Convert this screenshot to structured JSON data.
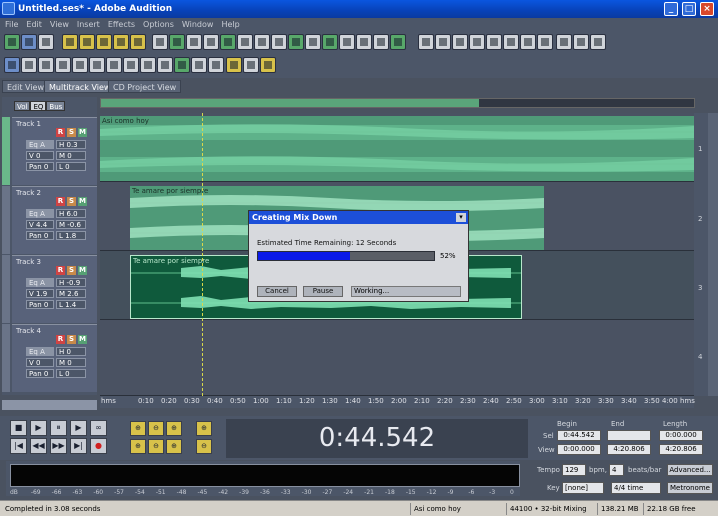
{
  "window": {
    "title": "Untitled.ses* - Adobe Audition",
    "buttons": [
      "_",
      "□",
      "×"
    ]
  },
  "menu": [
    "File",
    "Edit",
    "View",
    "Insert",
    "Effects",
    "Options",
    "Window",
    "Help"
  ],
  "tabs": [
    "Edit View",
    "Multitrack View",
    "CD Project View"
  ],
  "active_tab": "Multitrack View",
  "track_control_tabs": [
    "Vol",
    "EQ",
    "Bus"
  ],
  "tracks": [
    {
      "name": "Track 1",
      "eq": "Eq A",
      "h": "H  0.3",
      "v": "V 0",
      "m": "M  0",
      "pan": "Pan 0",
      "l": "L  0"
    },
    {
      "name": "Track 2",
      "eq": "Eq A",
      "h": "H  6.0",
      "v": "V 4.4",
      "m": "M  -0.6",
      "pan": "Pan 0",
      "l": "L  1.8"
    },
    {
      "name": "Track 3",
      "eq": "Eq A",
      "h": "H  -0.9",
      "v": "V 1.9",
      "m": "M  2.6",
      "pan": "Pan 0",
      "l": "L  1.4"
    },
    {
      "name": "Track 4",
      "eq": "Eq A",
      "h": "H  0",
      "v": "V 0",
      "m": "M  0",
      "pan": "Pan 0",
      "l": "L  0"
    }
  ],
  "rsm": [
    "R",
    "S",
    "M"
  ],
  "clips": [
    {
      "name": "Asi como hoy"
    },
    {
      "name": "Te amare por siempre"
    },
    {
      "name": "Te amare por siempre"
    }
  ],
  "lane_numbers": [
    "1",
    "2",
    "3",
    "4"
  ],
  "timeline": {
    "unit": "hms",
    "ticks": [
      "0:10",
      "0:20",
      "0:30",
      "0:40",
      "0:50",
      "1:00",
      "1:10",
      "1:20",
      "1:30",
      "1:40",
      "1:50",
      "2:00",
      "2:10",
      "2:20",
      "2:30",
      "2:40",
      "2:50",
      "3:00",
      "3:10",
      "3:20",
      "3:30",
      "3:40",
      "3:50",
      "4:00",
      "4:10"
    ],
    "end_unit": "hms"
  },
  "dialog": {
    "title": "Creating Mix Down",
    "eta": "Estimated Time Remaining: 12 Seconds",
    "progress": 0.52,
    "percent": "52%",
    "cancel": "Cancel",
    "pause": "Pause",
    "status": "Working..."
  },
  "transport": {
    "time": "0:44.542",
    "buttons": [
      "■",
      "▶",
      "⏸",
      "▶",
      "∞",
      "|◀",
      "◀◀",
      "▶▶",
      "▶|",
      "●"
    ],
    "zoom": [
      "⊕",
      "⊖",
      "⊕",
      "⊕",
      "⊕",
      "⊖",
      "⊕",
      "⊖"
    ]
  },
  "selection": {
    "headers": [
      "Begin",
      "End",
      "Length"
    ],
    "rows": [
      {
        "label": "Sel",
        "begin": "0:44.542",
        "end": "",
        "length": "0:00.000"
      },
      {
        "label": "View",
        "begin": "0:00.000",
        "end": "4:20.806",
        "length": "4:20.806"
      }
    ]
  },
  "meter": {
    "labels": [
      "dB",
      "-69",
      "-66",
      "-63",
      "-60",
      "-57",
      "-54",
      "-51",
      "-48",
      "-45",
      "-42",
      "-39",
      "-36",
      "-33",
      "-30",
      "-27",
      "-24",
      "-21",
      "-18",
      "-15",
      "-12",
      "-9",
      "-6",
      "-3",
      "0"
    ]
  },
  "tempo": {
    "tempo_label": "Tempo",
    "tempo": "129",
    "bpm": "bpm,",
    "beats": "4",
    "beats_label": "beats/bar",
    "advanced": "Advanced...",
    "key_label": "Key",
    "key": "[none]",
    "time_sig": "4/4 time",
    "metronome": "Metronome"
  },
  "status": {
    "message": "Completed in 3.08 seconds",
    "file": "Asi como hoy",
    "format": "44100 • 32-bit Mixing",
    "size": "138.21 MB",
    "free": "22.18 GB free"
  }
}
